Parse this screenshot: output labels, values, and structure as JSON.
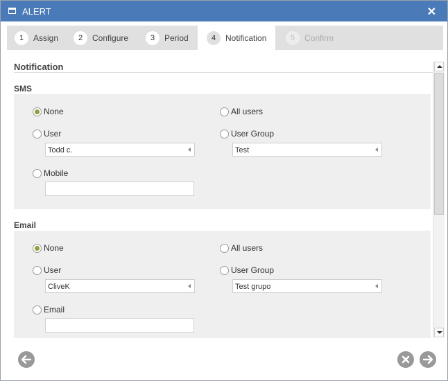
{
  "window": {
    "title": "ALERT",
    "close_glyph": "✕"
  },
  "steps": [
    {
      "num": "1",
      "label": "Assign",
      "state": "done"
    },
    {
      "num": "2",
      "label": "Configure",
      "state": "done"
    },
    {
      "num": "3",
      "label": "Period",
      "state": "done"
    },
    {
      "num": "4",
      "label": "Notification",
      "state": "active"
    },
    {
      "num": "5",
      "label": "Confirm",
      "state": "disabled"
    }
  ],
  "section": {
    "title": "Notification"
  },
  "sms": {
    "label": "SMS",
    "none": "None",
    "all_users": "All users",
    "user": "User",
    "user_value": "Todd c.",
    "user_group": "User Group",
    "group_value": "Test",
    "mobile": "Mobile",
    "mobile_value": "",
    "selected": "none"
  },
  "email": {
    "label": "Email",
    "none": "None",
    "all_users": "All users",
    "user": "User",
    "user_value": "CliveK",
    "user_group": "User Group",
    "group_value": "Test grupo",
    "email": "Email",
    "email_value": "",
    "selected": "none"
  },
  "icons": {
    "back": "arrow-left-icon",
    "cancel": "cross-icon",
    "next": "arrow-right-icon"
  },
  "colors": {
    "titlebar": "#4a7ab8",
    "radio_selected": "#8da13a",
    "button": "#999999"
  }
}
